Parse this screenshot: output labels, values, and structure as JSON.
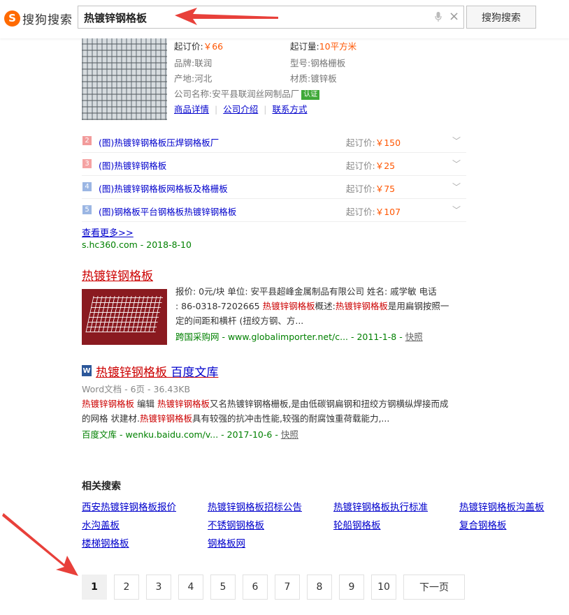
{
  "header": {
    "logo_mark": "S",
    "logo_text": "搜狗搜索",
    "query": "热镀锌钢格板",
    "search_button": "搜狗搜索"
  },
  "product": {
    "min_price_label": "起订价:",
    "min_price": "￥66",
    "min_qty_label": "起订量:",
    "min_qty": "10平方米",
    "brand": "品牌:联润",
    "model": "型号:钢格栅板",
    "origin": "产地:河北",
    "material": "材质:镀锌板",
    "company": "公司名称:安平县联润丝网制品厂",
    "cert": "认证",
    "links": [
      "商品详情",
      "公司介绍",
      "联系方式"
    ]
  },
  "offers": [
    {
      "num": "2",
      "title": "(图)热镀锌钢格板压焊钢格板厂",
      "label": "起订价:",
      "price": "￥150",
      "color": "#f29b9b"
    },
    {
      "num": "3",
      "title": "(图)热镀锌钢格板",
      "label": "起订价:",
      "price": "￥25",
      "color": "#f5a3a3"
    },
    {
      "num": "4",
      "title": "(图)热镀锌钢格板网格板及格栅板",
      "label": "起订价:",
      "price": "￥75",
      "color": "#9bb6e3"
    },
    {
      "num": "5",
      "title": "(图)钢格板平台钢格板热镀锌钢格板",
      "label": "起订价:",
      "price": "￥107",
      "color": "#9bb6e3"
    }
  ],
  "more_link": "查看更多>>",
  "cite1": "s.hc360.com - 2018-8-10",
  "result2": {
    "title": "热镀锌钢格板",
    "line1": "报价: 0元/块 单位: 安平县超峰金属制品有限公司 姓名: 戚学敏 电话",
    "line2_a": ": 86-0318-7202665 ",
    "line2_em1": "热镀锌钢格板",
    "line2_b": "概述:",
    "line2_em2": "热镀锌钢格板",
    "line2_c": "是用扁钢按照一",
    "line3": "定的间距和横杆 (扭绞方钢、方...",
    "cite": "跨国采购网 - www.globalimporter.net/c... - 2011-1-8 - ",
    "snapshot": "快照"
  },
  "result3": {
    "icon": "W",
    "title_em": "热镀锌钢格板",
    "title_rest": " 百度文库",
    "meta": "Word文档 - 6页 - 36.43KB",
    "l1_em1": "热镀锌钢格板",
    "l1_a": " 编辑 ",
    "l1_em2": "热镀锌钢格板",
    "l1_b": "又名热镀锌钢格栅板,是由低碳钢扁钢和扭绞方钢横纵焊接而成",
    "l2_a": "的网格 状建材.",
    "l2_em": "热镀锌钢格板",
    "l2_b": "具有较强的抗冲击性能,较强的耐腐蚀重荷载能力,...",
    "cite": "百度文库 - wenku.baidu.com/v... - 2017-10-6 - ",
    "snapshot": "快照"
  },
  "related": {
    "title": "相关搜索",
    "items": [
      "西安热镀锌钢格板报价",
      "热镀锌钢格板招标公告",
      "热镀锌钢格板执行标准",
      "热镀锌钢格板沟盖板",
      "水沟盖板",
      "不锈钢钢格板",
      "轮船钢格板",
      "复合钢格板",
      "楼梯钢格板",
      "钢格板网"
    ]
  },
  "pagination": {
    "pages": [
      "1",
      "2",
      "3",
      "4",
      "5",
      "6",
      "7",
      "8",
      "9",
      "10"
    ],
    "current": "1",
    "next": "下一页"
  },
  "colors": {
    "accent": "#ff6a00",
    "link": "#0000cc",
    "highlight": "#cc0000",
    "cite": "#008000",
    "price": "#ff5500",
    "annotation_arrow": "#e8403a"
  }
}
